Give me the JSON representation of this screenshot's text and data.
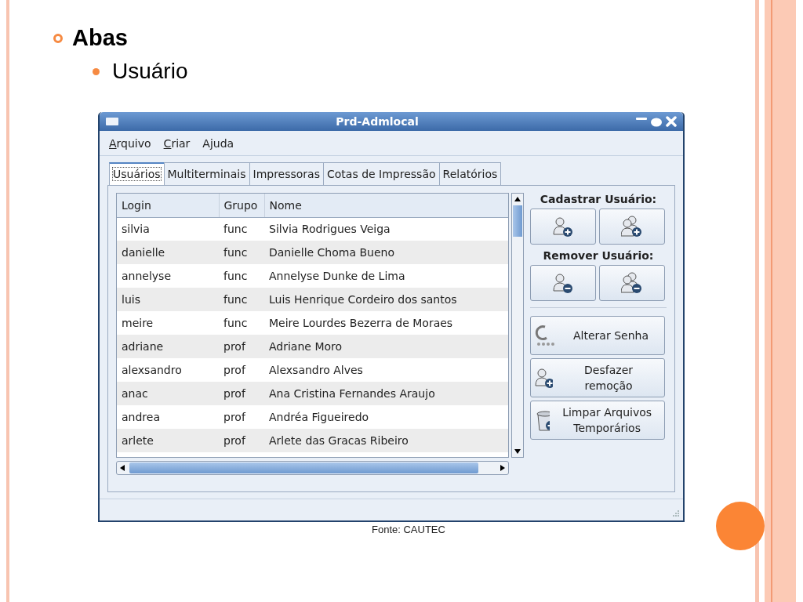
{
  "slide": {
    "heading": "Abas",
    "subheading": "Usuário",
    "caption": "Fonte: CAUTEC"
  },
  "window": {
    "title": "Prd-Admlocal"
  },
  "menu": [
    {
      "label": "Arquivo",
      "underline_first": true
    },
    {
      "label": "Criar",
      "underline_first": true
    },
    {
      "label": "Ajuda",
      "underline_first": false
    }
  ],
  "tabs": [
    {
      "label": "Usuários",
      "selected": true
    },
    {
      "label": "Multiterminais",
      "selected": false
    },
    {
      "label": "Impressoras",
      "selected": false
    },
    {
      "label": "Cotas de Impressão",
      "selected": false
    },
    {
      "label": "Relatórios",
      "selected": false
    }
  ],
  "table": {
    "columns": [
      "Login",
      "Grupo",
      "Nome"
    ],
    "rows": [
      [
        "silvia",
        "func",
        "Silvia Rodrigues Veiga"
      ],
      [
        "danielle",
        "func",
        "Danielle Choma Bueno"
      ],
      [
        "annelyse",
        "func",
        "Annelyse Dunke de Lima"
      ],
      [
        "luis",
        "func",
        "Luis Henrique Cordeiro dos santos"
      ],
      [
        "meire",
        "func",
        "Meire Lourdes Bezerra de Moraes"
      ],
      [
        "adriane",
        "prof",
        "Adriane Moro"
      ],
      [
        "alexsandro",
        "prof",
        "Alexsandro Alves"
      ],
      [
        "anac",
        "prof",
        "Ana Cristina Fernandes Araujo"
      ],
      [
        "andrea",
        "prof",
        "Andréa Figueiredo"
      ],
      [
        "arlete",
        "prof",
        "Arlete das Gracas Ribeiro"
      ]
    ]
  },
  "side_panel": {
    "sections": [
      {
        "heading": "Cadastrar Usuário:"
      },
      {
        "heading": "Remover Usuário:"
      }
    ],
    "buttons": [
      "Alterar Senha",
      "Desfazer remoção",
      "Limpar Arquivos Temporários"
    ]
  }
}
